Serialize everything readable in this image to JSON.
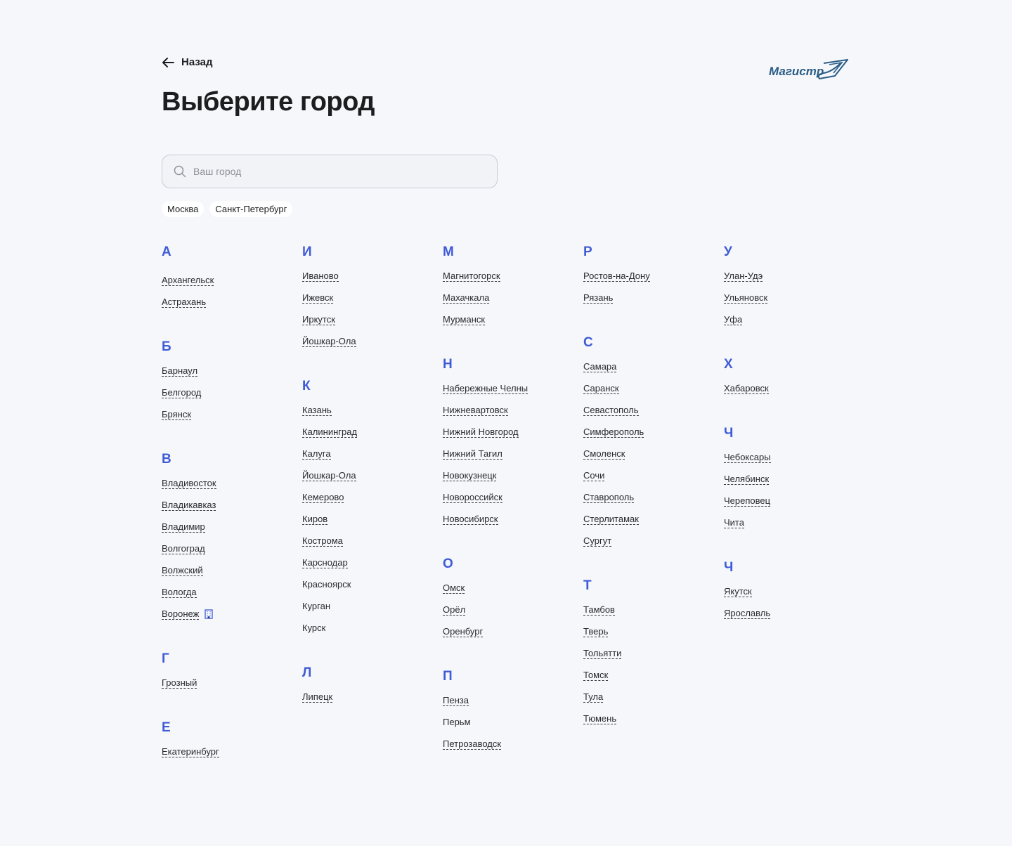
{
  "header": {
    "back_label": "Назад",
    "title": "Выберите город",
    "logo_text": "Магистр"
  },
  "search": {
    "placeholder": "Ваш город"
  },
  "popular": [
    "Москва",
    "Санкт-Петербург"
  ],
  "columns": [
    [
      {
        "letter": "А",
        "cities": [
          "Архангельск",
          "Астрахань"
        ]
      },
      {
        "letter": "Б",
        "cities": [
          "Барнаул",
          "Белгород",
          "Брянск"
        ]
      },
      {
        "letter": "В",
        "cities": [
          "Владивосток",
          "Владикавказ",
          "Владимир",
          "Волгоград",
          "Волжский",
          "Вологда",
          "Воронеж"
        ]
      },
      {
        "letter": "Г",
        "cities": [
          "Грозный"
        ]
      },
      {
        "letter": "Е",
        "cities": [
          "Екатеринбург"
        ]
      }
    ],
    [
      {
        "letter": "И",
        "cities": [
          "Иваново",
          "Ижевск",
          "Иркутск",
          "Йошкар-Ола"
        ]
      },
      {
        "letter": "К",
        "cities": [
          "Казань",
          "Калининград",
          "Калуга",
          "Йошкар-Ола",
          "Кемерово",
          "Киров",
          "Кострома",
          "Карснодар",
          "Красноярск",
          "Курган",
          "Курск"
        ]
      },
      {
        "letter": "Л",
        "cities": [
          "Липецк"
        ]
      }
    ],
    [
      {
        "letter": "М",
        "cities": [
          "Магнитогорск",
          "Махачкала",
          "Мурманск"
        ]
      },
      {
        "letter": "Н",
        "cities": [
          "Набережные Челны",
          "Нижневартовск",
          "Нижний Новгород",
          "Нижний Тагил",
          "Новокузнецк",
          "Новороссийск",
          "Новосибирск"
        ]
      },
      {
        "letter": "О",
        "cities": [
          "Омск",
          "Орёл",
          "Оренбург"
        ]
      },
      {
        "letter": "П",
        "cities": [
          "Пенза",
          "Перьм",
          "Петрозаводск"
        ]
      }
    ],
    [
      {
        "letter": "Р",
        "cities": [
          "Ростов-на-Дону",
          "Рязань"
        ]
      },
      {
        "letter": "С",
        "cities": [
          "Самара",
          "Саранск",
          "Севастополь",
          "Симферополь",
          "Смоленск",
          "Сочи",
          "Ставрополь",
          "Стерлитамак",
          "Сургут"
        ]
      },
      {
        "letter": "Т",
        "cities": [
          "Тамбов",
          "Тверь",
          "Тольятти",
          "Томск",
          "Тула",
          "Тюмень"
        ]
      }
    ],
    [
      {
        "letter": "У",
        "cities": [
          "Улан-Удэ",
          "Ульяновск",
          "Уфа"
        ]
      },
      {
        "letter": "Х",
        "cities": [
          "Хабаровск"
        ]
      },
      {
        "letter": "Ч",
        "cities": [
          "Чебоксары",
          "Челябинск",
          "Череповец",
          "Чита"
        ]
      },
      {
        "letter": "Ч",
        "cities": [
          "Якутск",
          "Ярославль"
        ]
      }
    ]
  ],
  "plain_cities": [
    "Красноярск",
    "Курган",
    "Курск",
    "Перьм"
  ],
  "office_city": "Воронеж",
  "icons": {
    "back": "arrow-left-icon",
    "search": "search-icon",
    "office": "building-icon"
  },
  "colors": {
    "accent": "#3f5bd6",
    "logo": "#2c5d86",
    "background": "#f5f7fb"
  }
}
